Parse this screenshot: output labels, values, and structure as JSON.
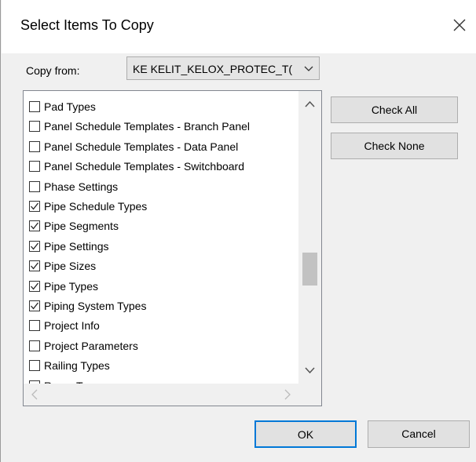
{
  "dialog": {
    "title": "Select Items To Copy",
    "close_icon": "close-icon"
  },
  "copy_from": {
    "label": "Copy from:",
    "selected_value": "KE KELIT_KELOX_PROTEC_T("
  },
  "items": [
    {
      "label": "Pad Types",
      "checked": false
    },
    {
      "label": "Panel Schedule Templates - Branch Panel",
      "checked": false
    },
    {
      "label": "Panel Schedule Templates - Data Panel",
      "checked": false
    },
    {
      "label": "Panel Schedule Templates - Switchboard",
      "checked": false
    },
    {
      "label": "Phase Settings",
      "checked": false
    },
    {
      "label": "Pipe Schedule Types",
      "checked": true
    },
    {
      "label": "Pipe Segments",
      "checked": true
    },
    {
      "label": "Pipe Settings",
      "checked": true
    },
    {
      "label": "Pipe Sizes",
      "checked": true
    },
    {
      "label": "Pipe Types",
      "checked": true
    },
    {
      "label": "Piping System Types",
      "checked": true
    },
    {
      "label": "Project Info",
      "checked": false
    },
    {
      "label": "Project Parameters",
      "checked": false
    },
    {
      "label": "Railing Types",
      "checked": false
    },
    {
      "label": "Ramp Types",
      "checked": false
    }
  ],
  "buttons": {
    "check_all": "Check All",
    "check_none": "Check None",
    "ok": "OK",
    "cancel": "Cancel"
  },
  "colors": {
    "accent": "#0078d7",
    "dialog_bg": "#f0f0f0",
    "list_bg": "#ffffff"
  }
}
